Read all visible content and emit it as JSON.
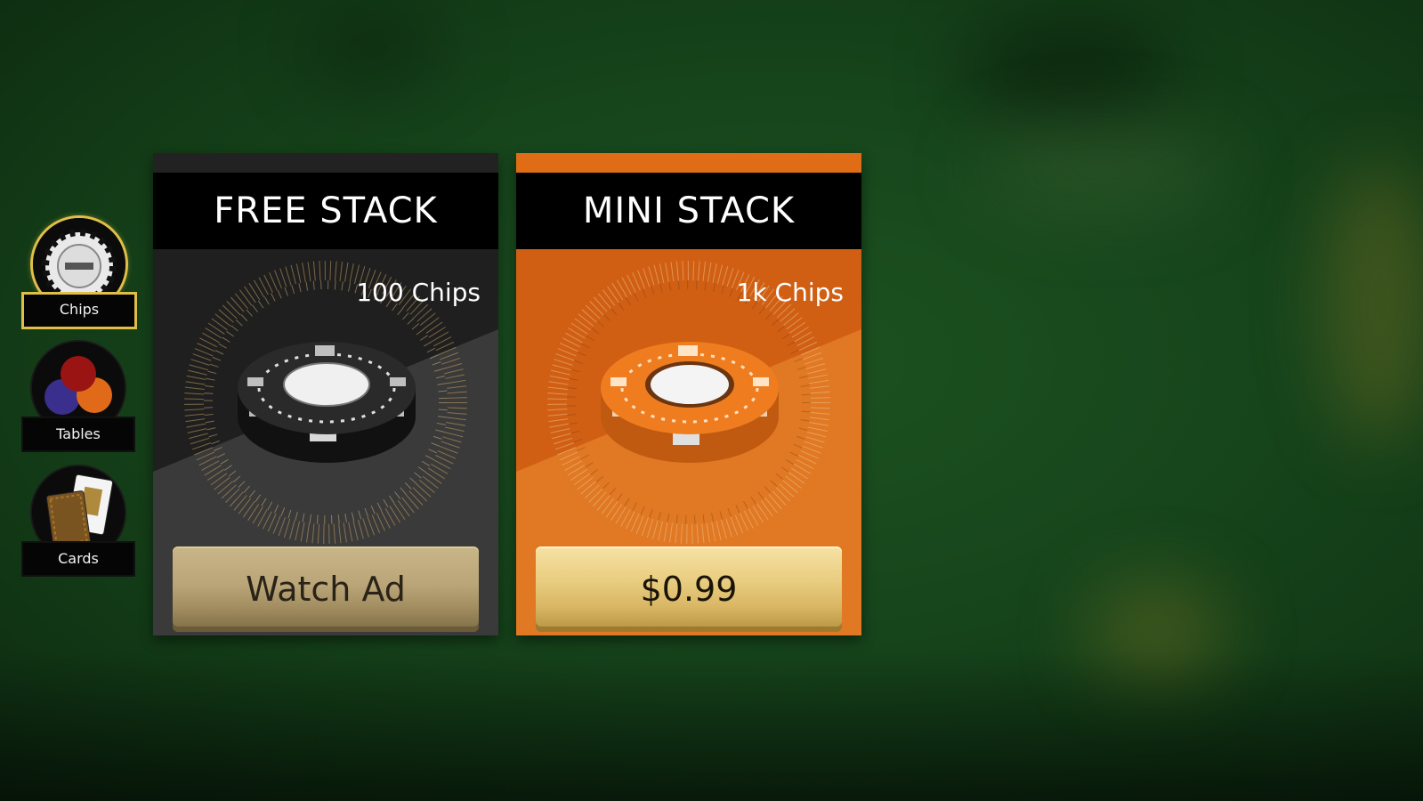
{
  "sidebar": {
    "items": [
      {
        "label": "Chips",
        "icon": "poker-chip-icon",
        "active": true
      },
      {
        "label": "Tables",
        "icon": "colored-circles-icon",
        "active": false
      },
      {
        "label": "Cards",
        "icon": "playing-cards-icon",
        "active": false
      }
    ]
  },
  "offers": [
    {
      "title": "FREE STACK",
      "amount": "100 Chips",
      "button": "Watch Ad",
      "color": "#2b2b2b",
      "chip_color": "#1e1e1e"
    },
    {
      "title": "MINI STACK",
      "amount": "1k Chips",
      "button": "$0.99",
      "color": "#d86718",
      "chip_color": "#ea7a1c"
    }
  ],
  "colors": {
    "table_felt": "#17461c",
    "active_outline": "#e0bf48"
  }
}
